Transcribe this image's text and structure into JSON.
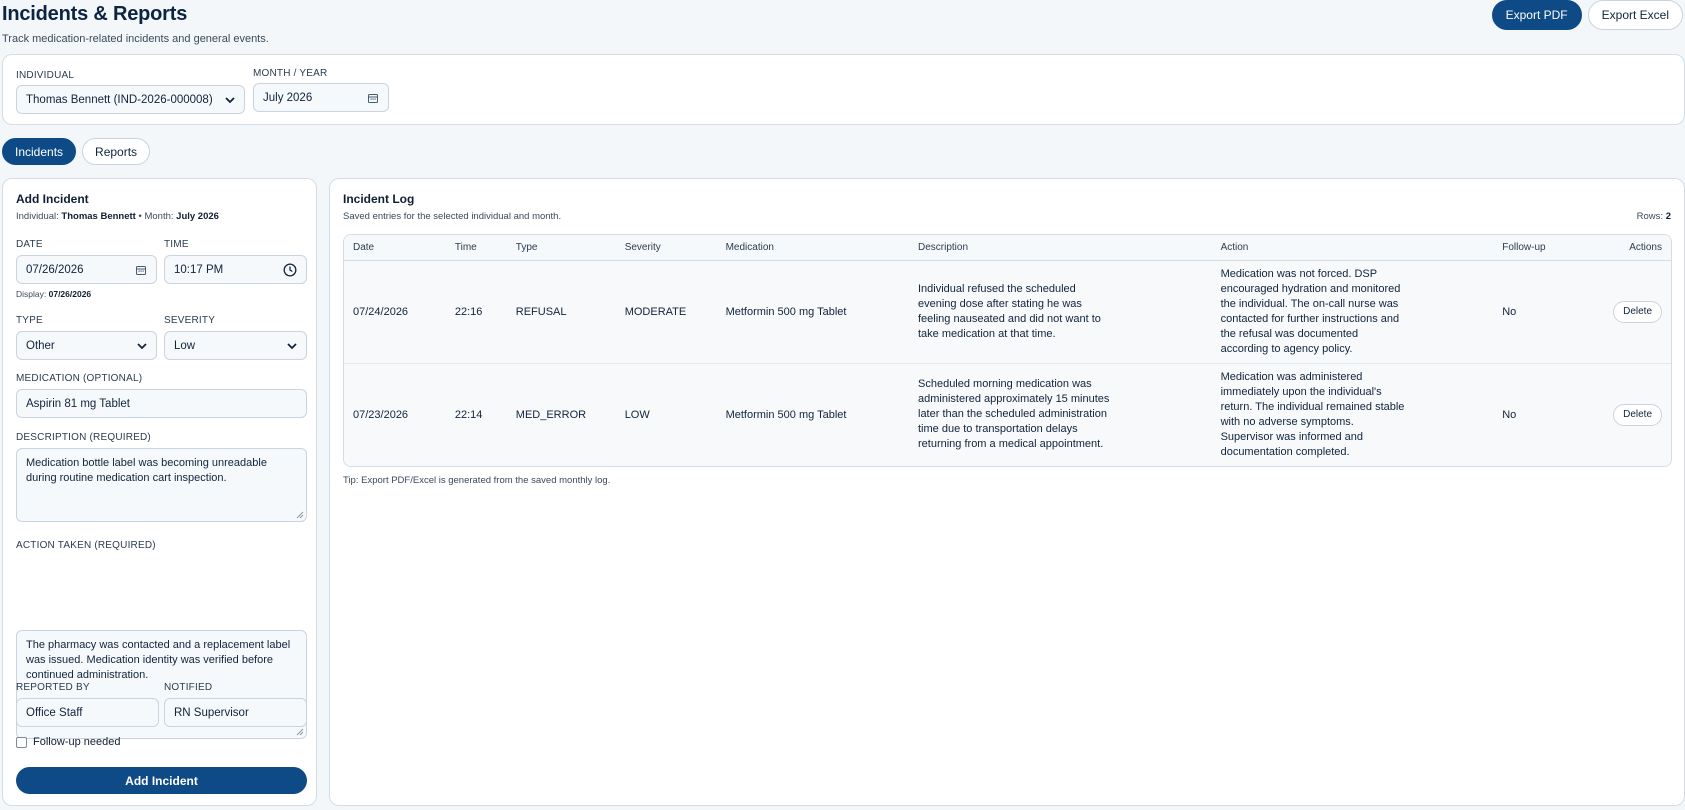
{
  "header": {
    "title": "Incidents & Reports",
    "subtitle": "Track medication-related incidents and general events.",
    "export_pdf": "Export PDF",
    "export_excel": "Export Excel"
  },
  "filters": {
    "individual_label": "INDIVIDUAL",
    "individual_value": "Thomas Bennett (IND-2026-000008)",
    "month_label": "MONTH / YEAR",
    "month_value": "July 2026"
  },
  "tabs": [
    {
      "label": "Incidents",
      "active": true
    },
    {
      "label": "Reports",
      "active": false
    }
  ],
  "add_incident": {
    "title": "Add Incident",
    "meta_individual_label": "Individual:",
    "meta_individual": "Thomas Bennett",
    "meta_sep": "•",
    "meta_month_label": "Month:",
    "meta_month": "July 2026",
    "date_label": "DATE",
    "date_value": "07/26/2026",
    "time_label": "TIME",
    "time_value": "10:17 PM",
    "display_label": "Display:",
    "display_value": "07/26/2026",
    "type_label": "TYPE",
    "type_value": "Other",
    "severity_label": "SEVERITY",
    "severity_value": "Low",
    "medication_label": "MEDICATION (OPTIONAL)",
    "medication_value": "Aspirin 81 mg Tablet",
    "description_label": "DESCRIPTION (REQUIRED)",
    "description_value": "Medication bottle label was becoming unreadable during routine medication cart inspection.",
    "action_label": "ACTION TAKEN (REQUIRED)",
    "action_value": "The pharmacy was contacted and a replacement label was issued. Medication identity was verified before continued administration.",
    "reported_by_label": "REPORTED BY",
    "reported_by_value": "Office Staff",
    "notified_label": "NOTIFIED",
    "notified_value": "RN Supervisor",
    "followup_label": "Follow-up needed",
    "submit_label": "Add Incident"
  },
  "log": {
    "title": "Incident Log",
    "subtitle": "Saved entries for the selected individual and month.",
    "rows_label": "Rows:",
    "rows_count": "2",
    "columns": [
      "Date",
      "Time",
      "Type",
      "Severity",
      "Medication",
      "Description",
      "Action",
      "Follow-up",
      "Actions"
    ],
    "rows": [
      {
        "date": "07/24/2026",
        "time": "22:16",
        "type": "REFUSAL",
        "severity": "MODERATE",
        "medication": "Metformin 500 mg Tablet",
        "description": "Individual refused the scheduled evening dose after stating he was feeling nauseated and did not want to take medication at that time.",
        "action": "Medication was not forced. DSP encouraged hydration and monitored the individual. The on-call nurse was contacted for further instructions and the refusal was documented according to agency policy.",
        "followup": "No",
        "delete_label": "Delete"
      },
      {
        "date": "07/23/2026",
        "time": "22:14",
        "type": "MED_ERROR",
        "severity": "LOW",
        "medication": "Metformin 500 mg Tablet",
        "description": "Scheduled morning medication was administered approximately 15 minutes later than the scheduled administration time due to transportation delays returning from a medical appointment.",
        "action": "Medication was administered immediately upon the individual's return. The individual remained stable with no adverse symptoms. Supervisor was informed and documentation completed.",
        "followup": "No",
        "delete_label": "Delete"
      }
    ],
    "tip": "Tip: Export PDF/Excel is generated from the saved monthly log."
  }
}
